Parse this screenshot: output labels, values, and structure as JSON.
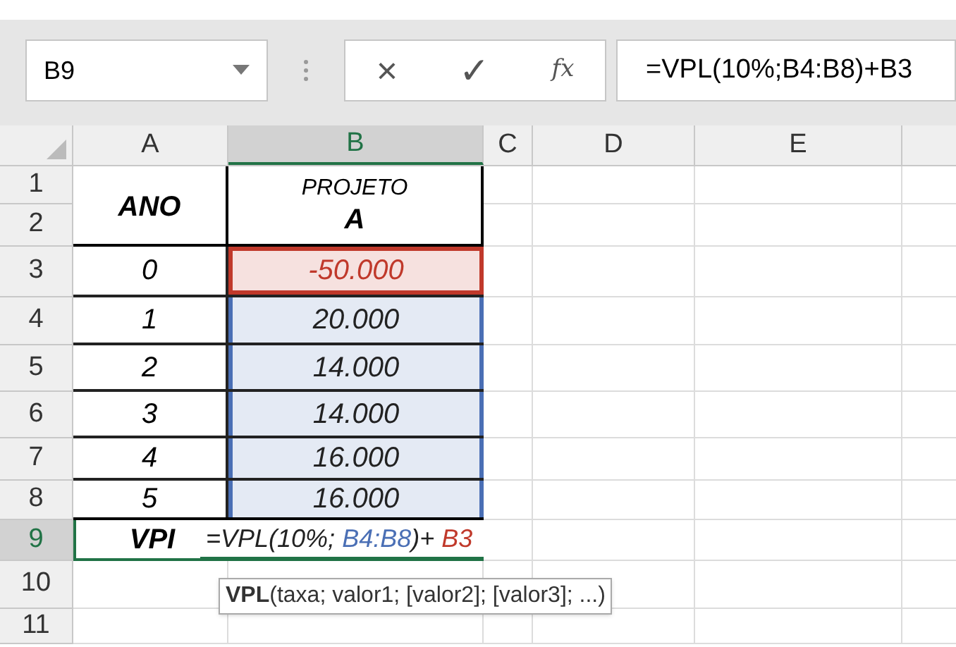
{
  "name_box": {
    "value": "B9"
  },
  "formula_bar": {
    "cancel": "×",
    "enter": "✓",
    "function": "fx",
    "value": "=VPL(10%;B4:B8)+B3"
  },
  "columns": [
    {
      "label": "A",
      "selected": false
    },
    {
      "label": "B",
      "selected": true
    },
    {
      "label": "C",
      "selected": false
    },
    {
      "label": "D",
      "selected": false
    },
    {
      "label": "E",
      "selected": false
    }
  ],
  "rows": [
    {
      "label": "1",
      "selected": false
    },
    {
      "label": "2",
      "selected": false
    },
    {
      "label": "3",
      "selected": false
    },
    {
      "label": "4",
      "selected": false
    },
    {
      "label": "5",
      "selected": false
    },
    {
      "label": "6",
      "selected": false
    },
    {
      "label": "7",
      "selected": false
    },
    {
      "label": "8",
      "selected": false
    },
    {
      "label": "9",
      "selected": true
    },
    {
      "label": "10",
      "selected": false
    },
    {
      "label": "11",
      "selected": false
    }
  ],
  "header": {
    "year": "ANO",
    "project_lines": [
      "PROJETO",
      "A"
    ]
  },
  "data": [
    {
      "year": "0",
      "value": "-50.000",
      "color": "#c0392b"
    },
    {
      "year": "1",
      "value": "20.000",
      "color": "#4a6fb5"
    },
    {
      "year": "2",
      "value": "14.000",
      "color": "#4a6fb5"
    },
    {
      "year": "3",
      "value": "14.000",
      "color": "#4a6fb5"
    },
    {
      "year": "4",
      "value": "16.000",
      "color": "#4a6fb5"
    },
    {
      "year": "5",
      "value": "16.000",
      "color": "#4a6fb5"
    }
  ],
  "result": {
    "label": "VPI",
    "formula": [
      {
        "text": "=VPL(10%; ",
        "color": "#222222"
      },
      {
        "text": "B4:B8",
        "color": "#4a6fb5"
      },
      {
        "text": ")+ ",
        "color": "#222222"
      },
      {
        "text": "B3",
        "color": "#c0392b"
      }
    ]
  },
  "tooltip": "**VPL**(taxa; valor1; [valor2]; [valor3]; ...)"
}
